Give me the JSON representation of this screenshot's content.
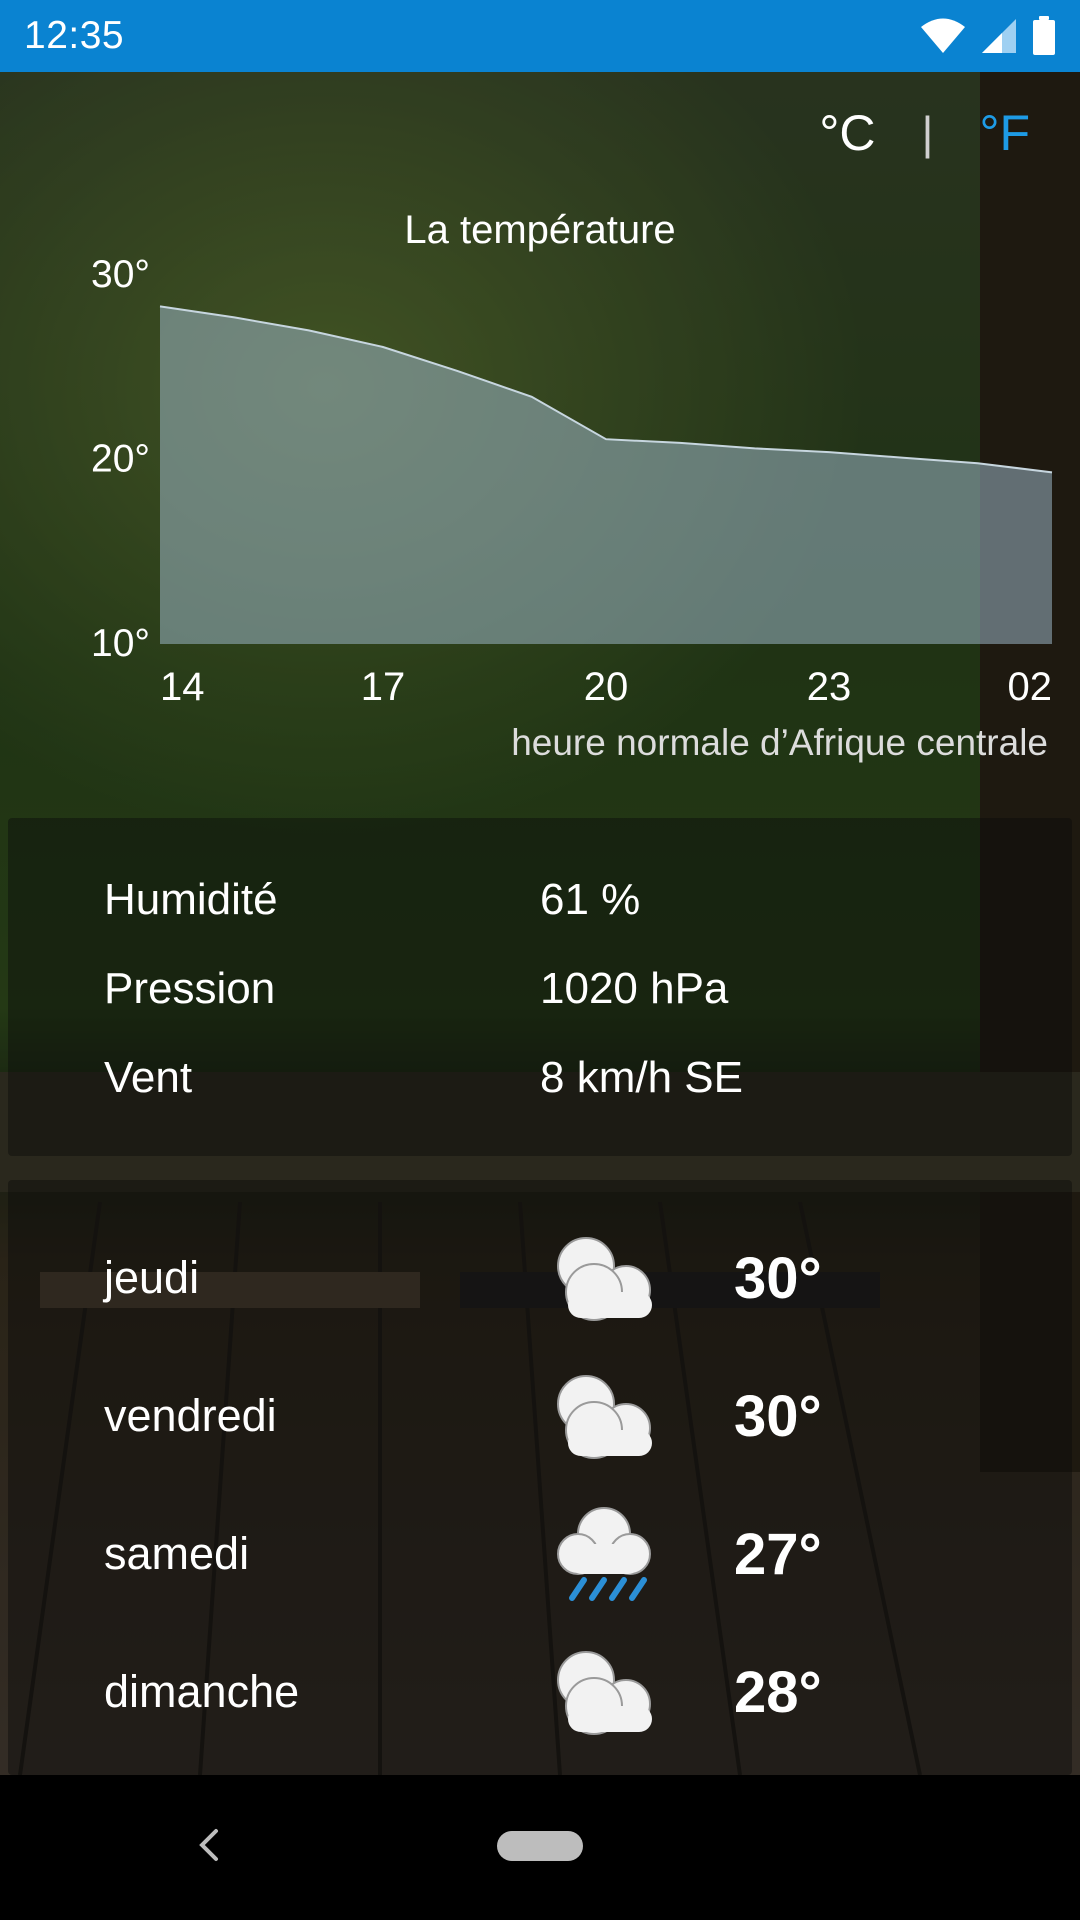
{
  "status_bar": {
    "time": "12:35",
    "icons": [
      "wifi-icon",
      "cell-signal-icon",
      "battery-icon"
    ],
    "color": "#0a83d1"
  },
  "units": {
    "celsius": "°C",
    "separator": "|",
    "fahrenheit": "°F",
    "active_color": "#1e9be6"
  },
  "chart_data": {
    "type": "area",
    "title": "La température",
    "x": [
      "14",
      "15",
      "16",
      "17",
      "18",
      "19",
      "20",
      "21",
      "22",
      "23",
      "00",
      "01",
      "02"
    ],
    "values": [
      28.3,
      27.7,
      27.0,
      26.1,
      24.8,
      23.4,
      21.1,
      20.9,
      20.6,
      20.4,
      20.1,
      19.8,
      19.3
    ],
    "x_tick_labels": [
      "14",
      "17",
      "20",
      "23",
      "02"
    ],
    "y_tick_labels": [
      "30°",
      "20°",
      "10°"
    ],
    "ylim": [
      10,
      30
    ],
    "xlabel": "heure normale d’Afrique centrale",
    "fill_color": "#9ab4c4"
  },
  "details": [
    {
      "label": "Humidité",
      "value": "61 %"
    },
    {
      "label": "Pression",
      "value": "1020 hPa"
    },
    {
      "label": "Vent",
      "value": "8 km/h SE"
    }
  ],
  "forecast": [
    {
      "day": "jeudi",
      "icon": "cloudy-icon",
      "temp": "30°"
    },
    {
      "day": "vendredi",
      "icon": "cloudy-icon",
      "temp": "30°"
    },
    {
      "day": "samedi",
      "icon": "rain-icon",
      "temp": "27°"
    },
    {
      "day": "dimanche",
      "icon": "cloudy-icon",
      "temp": "28°"
    }
  ]
}
